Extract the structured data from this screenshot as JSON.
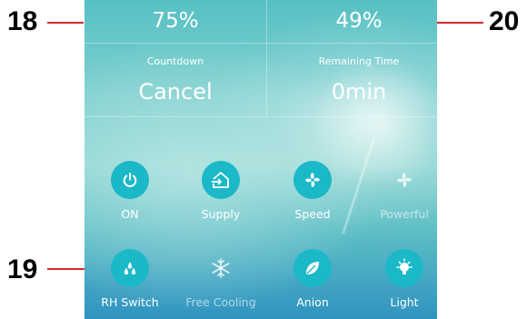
{
  "callouts": {
    "left_top": "18",
    "left_bottom": "19",
    "right_top": "20"
  },
  "stats": {
    "humidity_left": "75%",
    "humidity_right": "49%",
    "countdown_label": "Countdown",
    "countdown_value": "Cancel",
    "remaining_label": "Remaining Time",
    "remaining_value": "0min"
  },
  "buttons": [
    {
      "label": "ON",
      "icon": "power-icon",
      "active": true
    },
    {
      "label": "Supply",
      "icon": "house-arrow-icon",
      "active": true
    },
    {
      "label": "Speed",
      "icon": "fan-icon",
      "active": true
    },
    {
      "label": "Powerful",
      "icon": "fan-icon",
      "active": false
    },
    {
      "label": "RH Switch",
      "icon": "droplets-icon",
      "active": true
    },
    {
      "label": "Free Cooling",
      "icon": "snowflake-icon",
      "active": false
    },
    {
      "label": "Anion",
      "icon": "leaf-icon",
      "active": true
    },
    {
      "label": "Light",
      "icon": "bulb-icon",
      "active": true
    }
  ],
  "colors": {
    "accent": "#1bb8c8",
    "callout_line": "#d42a2a"
  }
}
